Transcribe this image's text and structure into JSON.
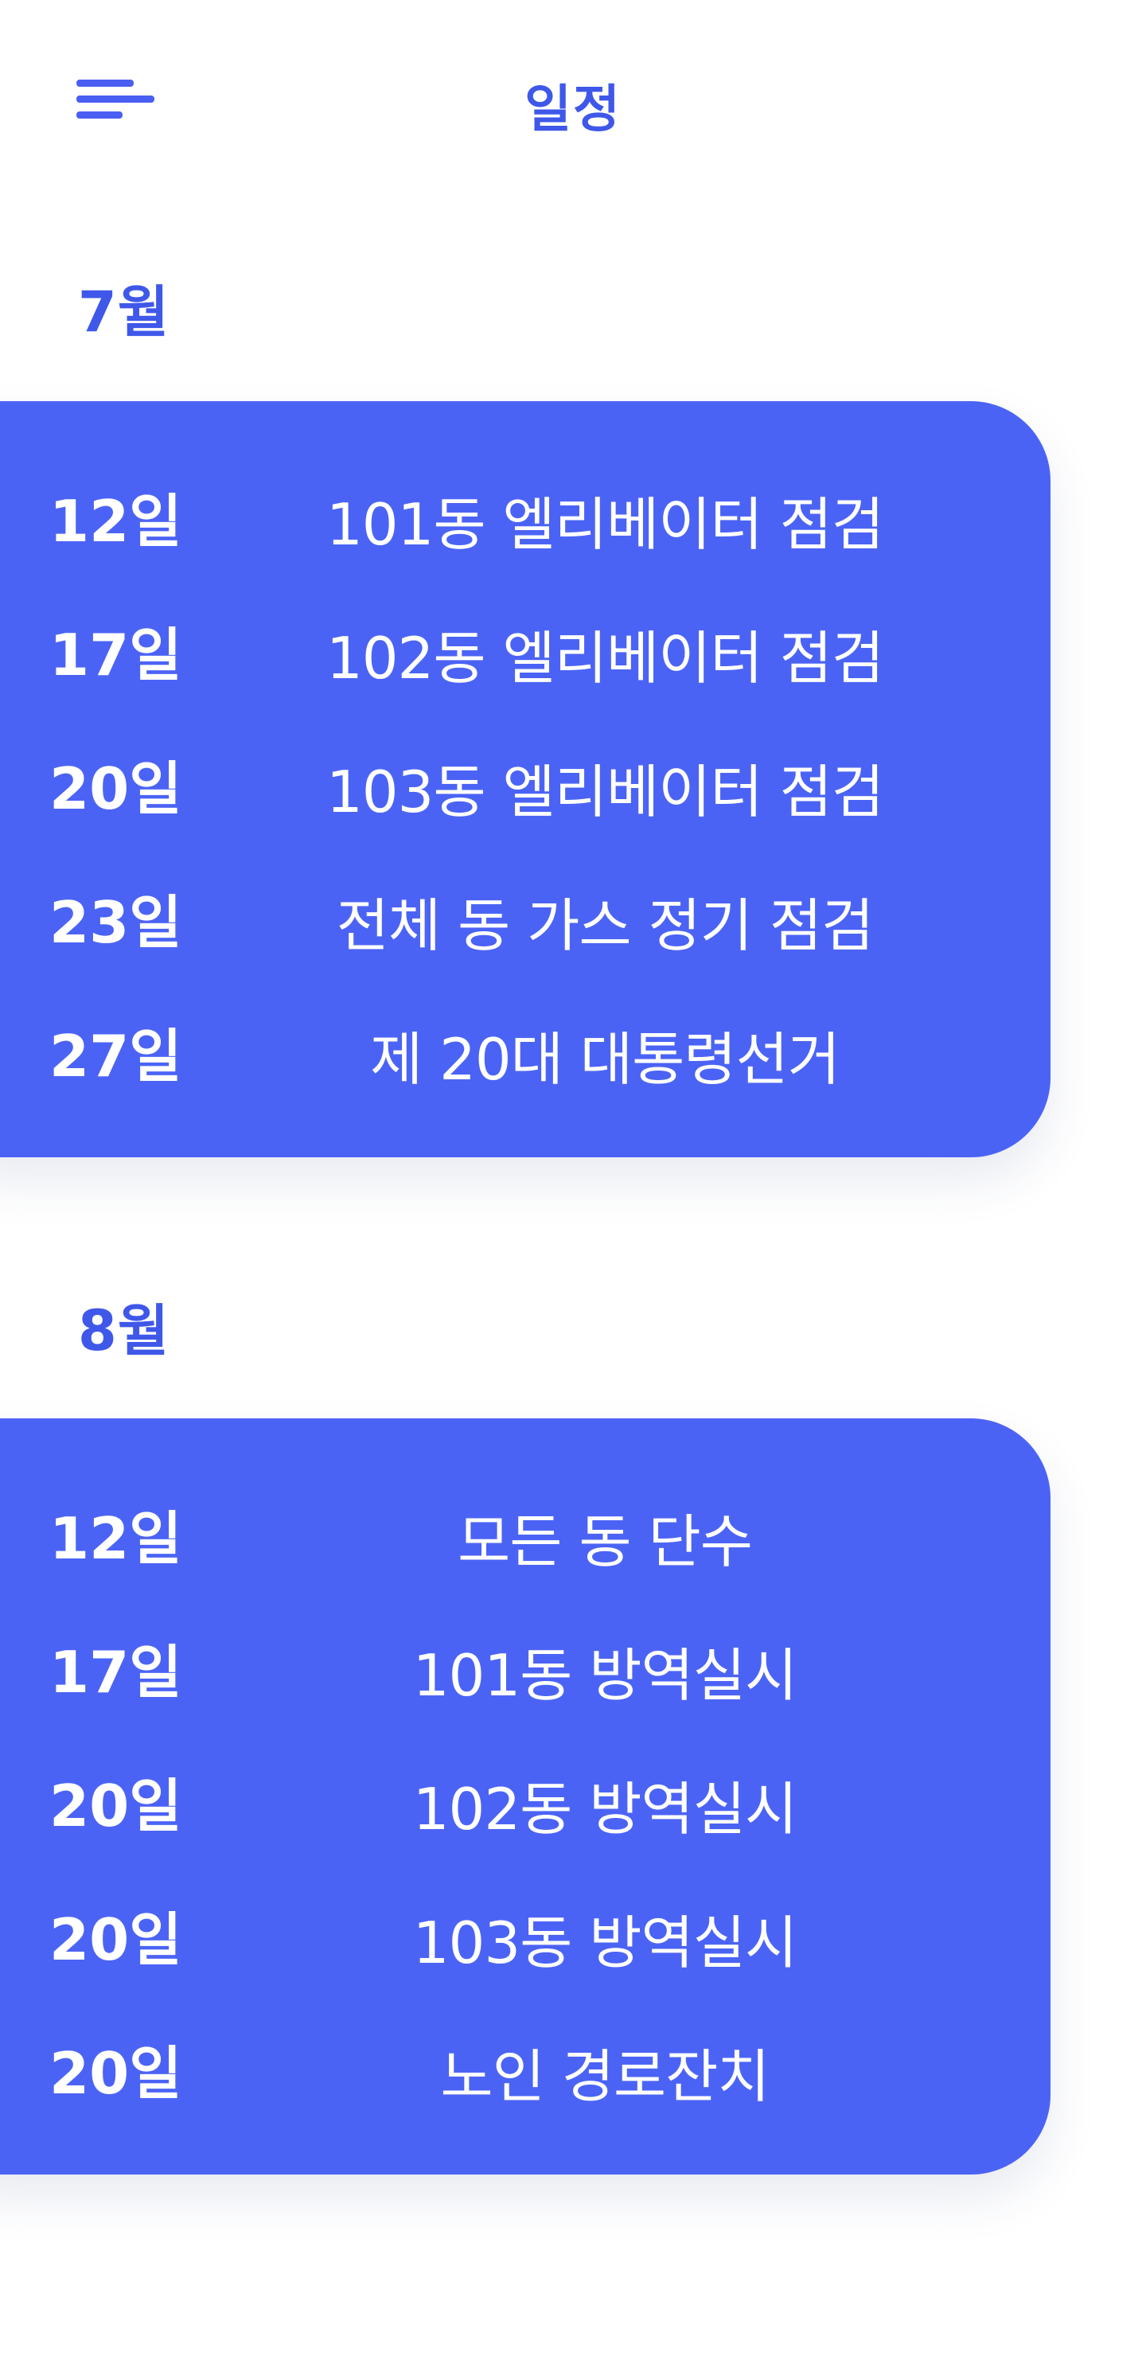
{
  "header": {
    "title": "일정",
    "menu_icon": "hamburger-menu-icon"
  },
  "accent_color": "#3f58e9",
  "card_color": "#4b63f5",
  "months": [
    {
      "label": "7월",
      "events": [
        {
          "day": "12일",
          "title": "101동 엘리베이터 점검"
        },
        {
          "day": "17일",
          "title": "102동 엘리베이터 점검"
        },
        {
          "day": "20일",
          "title": "103동 엘리베이터 점검"
        },
        {
          "day": "23일",
          "title": "전체 동 가스 정기 점검"
        },
        {
          "day": "27일",
          "title": "제 20대 대통령선거"
        }
      ]
    },
    {
      "label": "8월",
      "events": [
        {
          "day": "12일",
          "title": "모든 동 단수"
        },
        {
          "day": "17일",
          "title": "101동 방역실시"
        },
        {
          "day": "20일",
          "title": "102동 방역실시"
        },
        {
          "day": "20일",
          "title": "103동 방역실시"
        },
        {
          "day": "20일",
          "title": "노인 경로잔치"
        }
      ]
    }
  ]
}
